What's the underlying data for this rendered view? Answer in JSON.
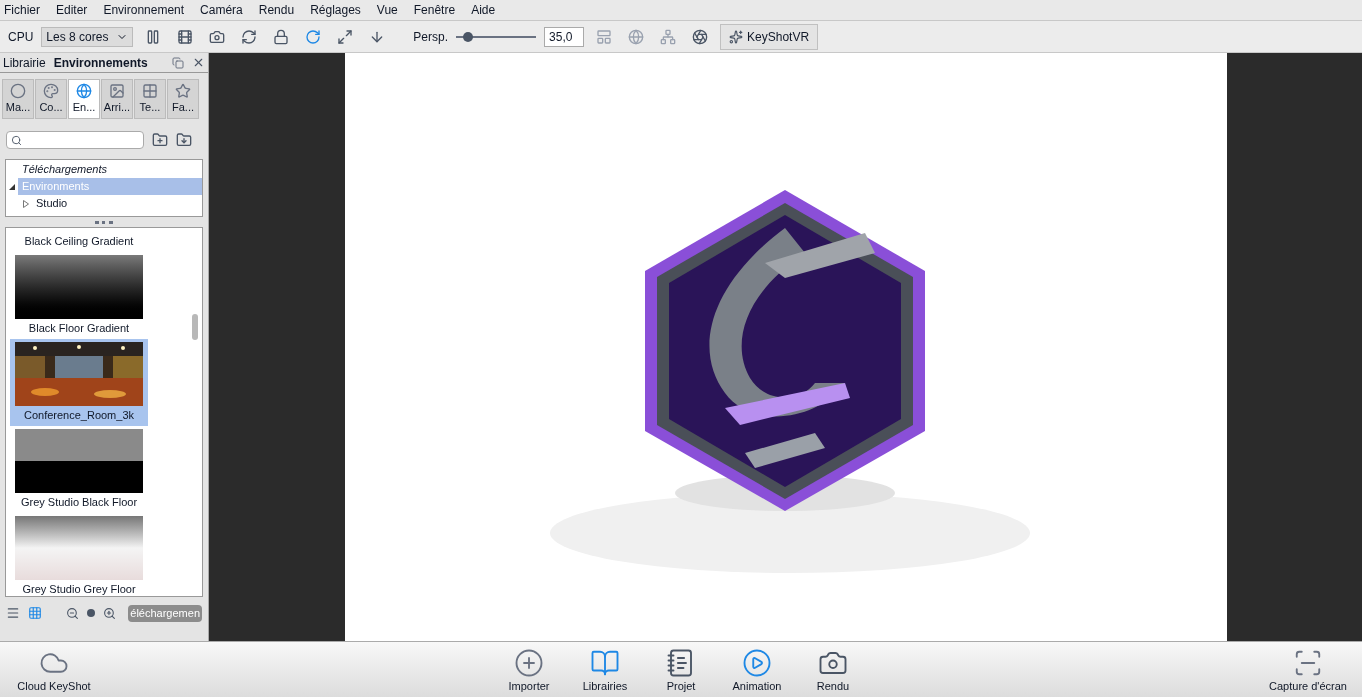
{
  "menu": [
    "Fichier",
    "Editer",
    "Environnement",
    "Caméra",
    "Rendu",
    "Réglages",
    "Vue",
    "Fenêtre",
    "Aide"
  ],
  "toolbar": {
    "cpu_label": "CPU",
    "cores": "Les 8 cores",
    "persp_label": "Persp.",
    "fov": {
      "level": 0.15
    },
    "fov_value": "35,0",
    "vr_button": "KeyShotVR"
  },
  "library": {
    "title": "Librairie",
    "section": "Environnements",
    "tabs": [
      {
        "label": "Ma...",
        "kind": "material",
        "selected": false
      },
      {
        "label": "Co...",
        "kind": "colors",
        "selected": false
      },
      {
        "label": "En...",
        "kind": "environment",
        "selected": true
      },
      {
        "label": "Arri...",
        "kind": "backplate",
        "selected": false
      },
      {
        "label": "Te...",
        "kind": "texture",
        "selected": false
      },
      {
        "label": "Fa...",
        "kind": "favorite",
        "selected": false
      }
    ],
    "tree": [
      {
        "label": "Téléchargements",
        "italic": true,
        "selected": false
      },
      {
        "label": "Environments",
        "italic": false,
        "selected": true,
        "expanded": true,
        "children": [
          {
            "label": "Studio",
            "italic": false,
            "selected": false,
            "expanded": false
          }
        ]
      }
    ],
    "items": [
      {
        "label": "Black Ceiling Gradient",
        "kind": "hidden",
        "selected": false
      },
      {
        "label": "Black Floor Gradient",
        "kind": "dark-gradient",
        "selected": false
      },
      {
        "label": "Conference_Room_3k",
        "kind": "picture",
        "selected": true
      },
      {
        "label": "Grey Studio Black Floor",
        "kind": "black-floor",
        "selected": false
      },
      {
        "label": "Grey Studio Grey Floor",
        "kind": "grey-floor",
        "selected": false
      }
    ],
    "view_modes": [
      {
        "kind": "list",
        "selected": false
      },
      {
        "kind": "grid",
        "selected": true
      }
    ],
    "download_button": "éléchargemen"
  },
  "dock": [
    {
      "label": "Cloud KeyShot",
      "kind": "cloud"
    },
    {
      "label": "Importer",
      "kind": "import"
    },
    {
      "label": "Librairies",
      "kind": "library"
    },
    {
      "label": "Projet",
      "kind": "project"
    },
    {
      "label": "Animation",
      "kind": "animation"
    },
    {
      "label": "Rendu",
      "kind": "render"
    },
    {
      "label": "Capture d'écran",
      "kind": "screenshot"
    }
  ]
}
